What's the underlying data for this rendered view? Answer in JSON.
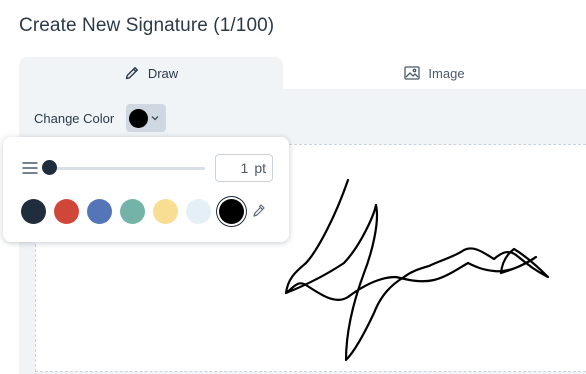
{
  "page": {
    "title": "Create New Signature (1/100)"
  },
  "tabs": [
    {
      "label": "Draw",
      "icon": "pencil-icon",
      "active": true
    },
    {
      "label": "Image",
      "icon": "image-icon",
      "active": false
    }
  ],
  "toolbar": {
    "change_color_label": "Change Color",
    "selected_color": "#000000"
  },
  "popup": {
    "thickness_value": "1",
    "thickness_unit": "pt",
    "swatches": [
      {
        "color": "#1f2d3d"
      },
      {
        "color": "#d0473a"
      },
      {
        "color": "#5476b8"
      },
      {
        "color": "#74b4a8"
      },
      {
        "color": "#f7de92"
      },
      {
        "color": "#e4f0f6"
      },
      {
        "color": "#000000",
        "selected": true
      }
    ]
  }
}
